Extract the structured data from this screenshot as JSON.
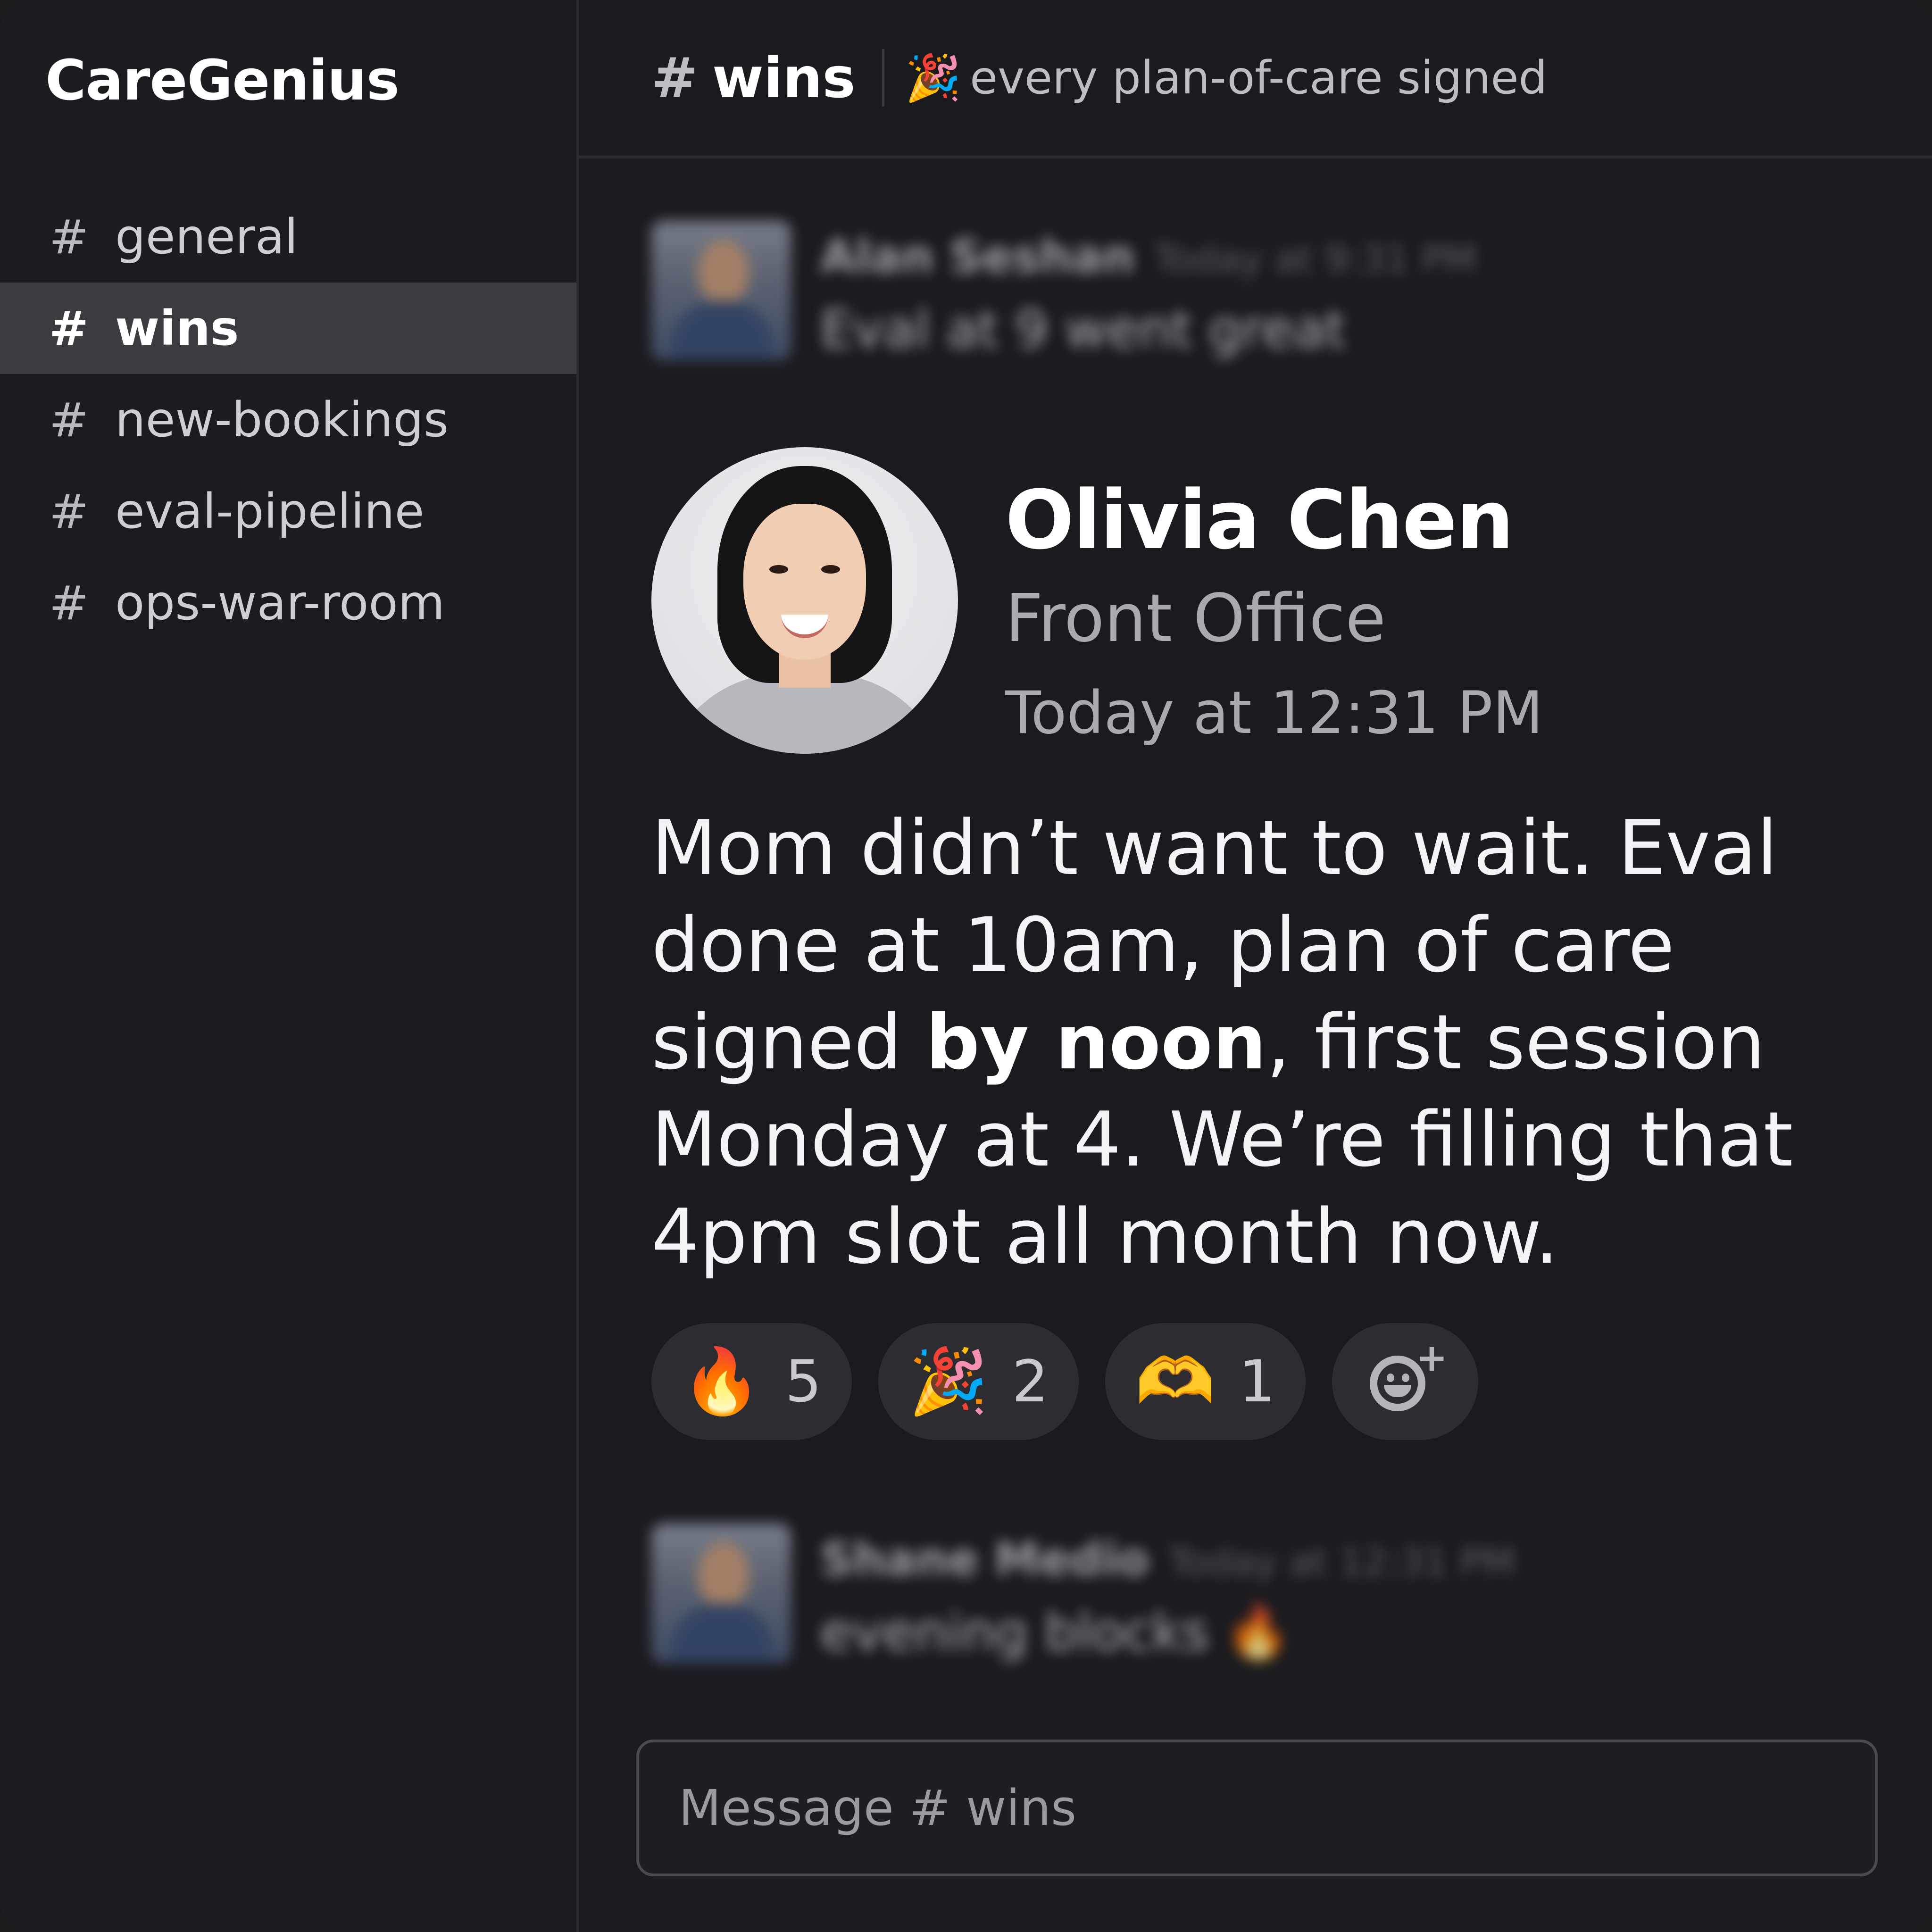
{
  "workspace": {
    "name": "CareGenius"
  },
  "sidebar": {
    "channels": [
      {
        "hash": "#",
        "label": "general"
      },
      {
        "hash": "#",
        "label": "wins"
      },
      {
        "hash": "#",
        "label": "new-bookings"
      },
      {
        "hash": "#",
        "label": "eval-pipeline"
      },
      {
        "hash": "#",
        "label": "ops-war-room"
      }
    ]
  },
  "header": {
    "channel_hash": "#",
    "channel_name": "wins",
    "topic_emoji": "🎉",
    "topic": "every plan-of-care signed"
  },
  "messages": {
    "previous": {
      "name": "Alan Seshan",
      "time": "Today at 9:31 PM",
      "text": "Eval at 9 went great"
    },
    "featured": {
      "name": "Olivia Chen",
      "role": "Front Office",
      "time": "Today at 12:31 PM",
      "body_part1": "Mom didn’t want to wait. Eval done at 10am, plan of care signed ",
      "body_bold": "by noon",
      "body_part2": ", first session Monday at 4. We’re filling that 4pm slot all month now.",
      "reactions": [
        {
          "emoji": "🔥",
          "count": "5"
        },
        {
          "emoji": "🎉",
          "count": "2"
        },
        {
          "emoji": "🫶",
          "count": "1"
        }
      ],
      "add_reaction_icon": "add-reaction-icon"
    },
    "next": {
      "name": "Shane Medio",
      "time": "Today at 12:31 PM",
      "text": "evening blocks 🔥"
    }
  },
  "composer": {
    "placeholder": "Message # wins"
  }
}
